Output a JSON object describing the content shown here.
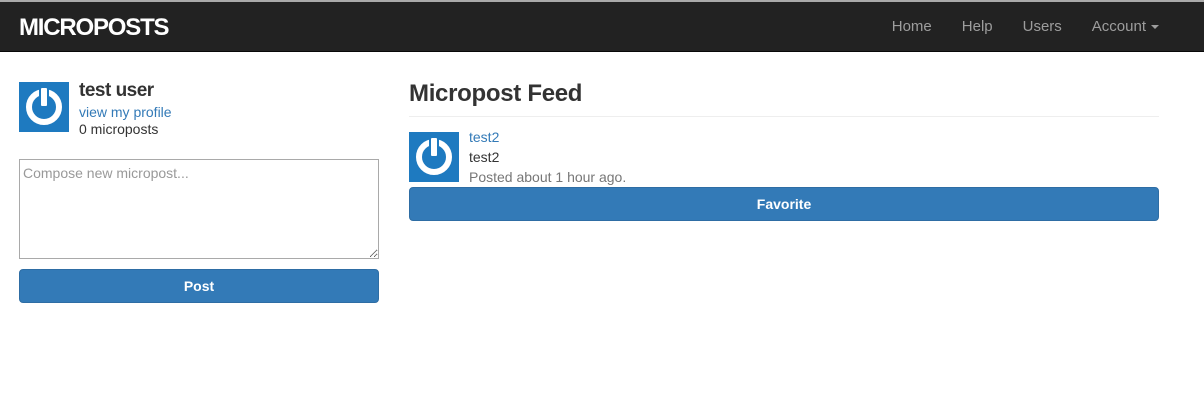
{
  "navbar": {
    "brand": "MICROPOSTS",
    "items": [
      {
        "label": "Home"
      },
      {
        "label": "Help"
      },
      {
        "label": "Users"
      },
      {
        "label": "Account"
      }
    ]
  },
  "sidebar": {
    "user_name": "test user",
    "profile_link": "view my profile",
    "micropost_count": "0 microposts",
    "compose_placeholder": "Compose new micropost...",
    "compose_value": "",
    "post_button": "Post",
    "avatar_icon": "gravatar-power-icon"
  },
  "feed": {
    "title": "Micropost Feed",
    "posts": [
      {
        "author": "test2",
        "content": "test2",
        "timestamp": "Posted about 1 hour ago.",
        "favorite_button": "Favorite",
        "avatar_icon": "gravatar-power-icon"
      }
    ]
  },
  "colors": {
    "navbar_bg": "#222222",
    "nav_link": "#9d9d9d",
    "primary": "#337ab7",
    "gravatar_bg": "#1e7ac0"
  }
}
